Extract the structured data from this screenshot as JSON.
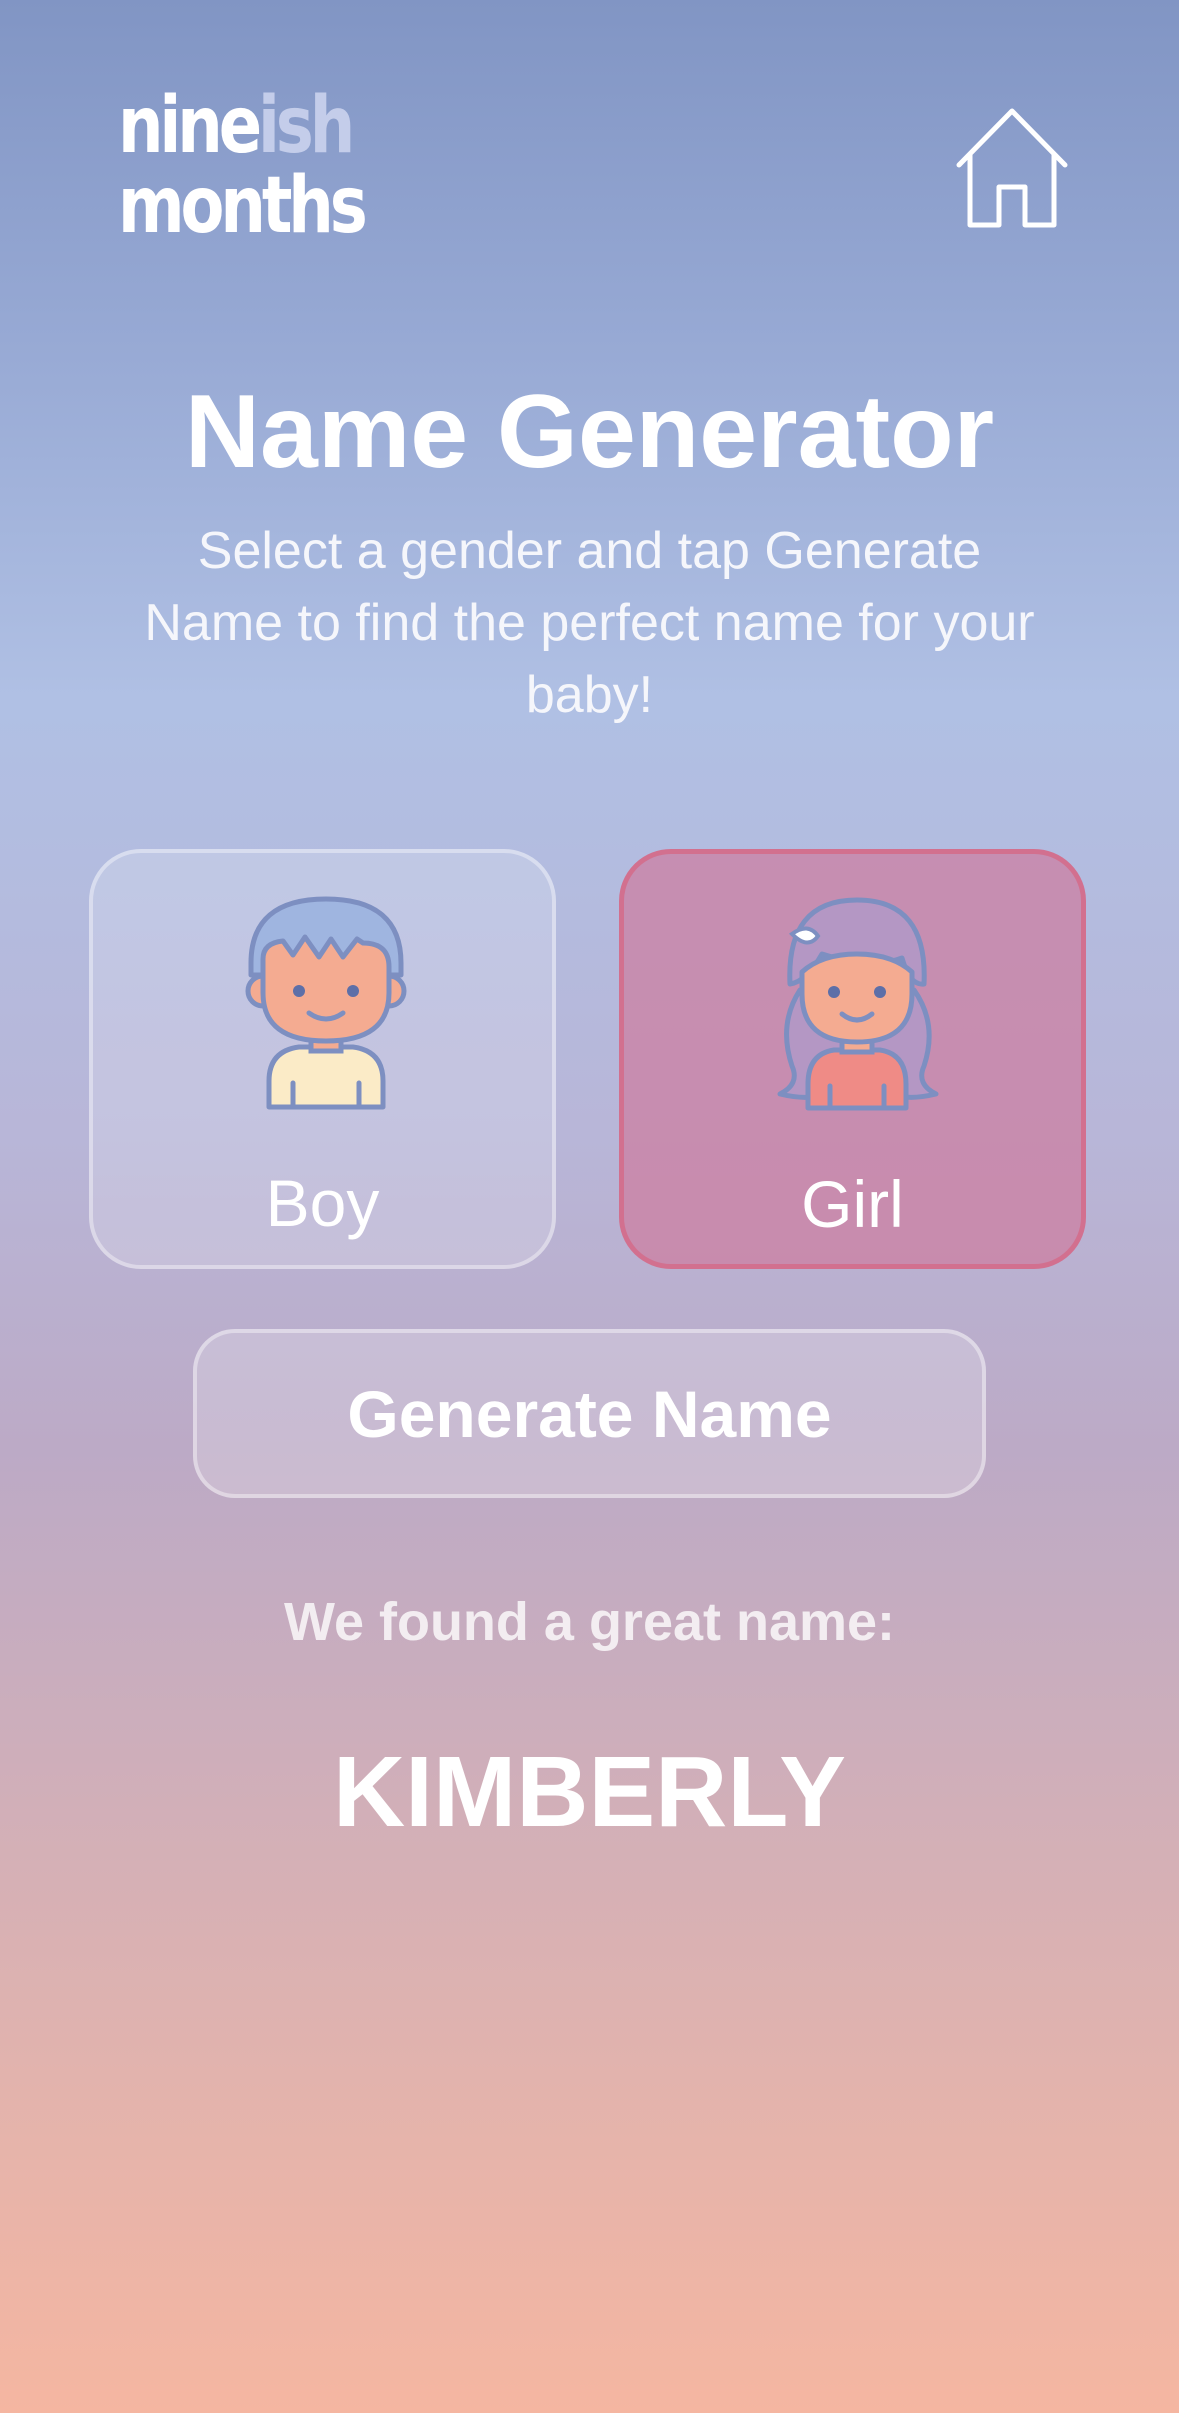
{
  "header": {
    "logo_line1_main": "nine",
    "logo_line1_accent": "ish",
    "logo_line2": "months",
    "home_icon": "home-icon"
  },
  "main": {
    "title": "Name Generator",
    "subtitle": "Select a gender and tap Generate Name to find the perfect name for your baby!"
  },
  "gender_options": [
    {
      "label": "Boy",
      "icon": "boy-avatar-icon",
      "selected": false
    },
    {
      "label": "Girl",
      "icon": "girl-avatar-icon",
      "selected": true
    }
  ],
  "generate_button": {
    "label": "Generate Name"
  },
  "result": {
    "intro": "We found a great name:",
    "name": "KIMBERLY"
  },
  "colors": {
    "gradient_top": "#8195c4",
    "gradient_bottom": "#f5b6a1",
    "girl_selected_bg": "#c98aab",
    "girl_selected_border": "#d2708f",
    "text": "#ffffff"
  }
}
